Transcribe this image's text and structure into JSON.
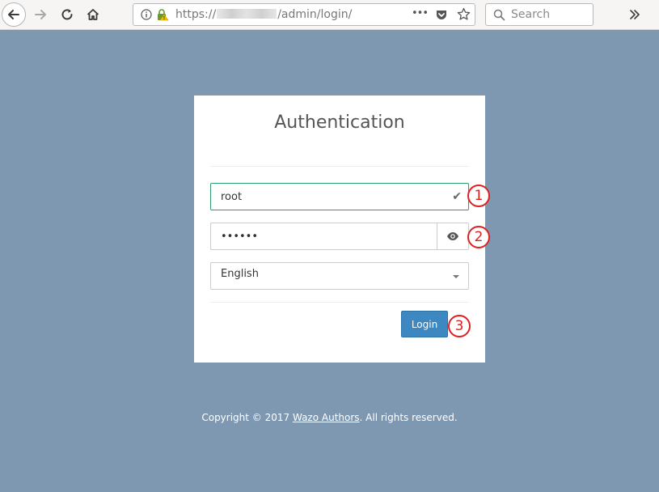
{
  "browser": {
    "url_prefix": "https://",
    "url_path": "/admin/login/",
    "search_placeholder": "Search",
    "more_label": "•••"
  },
  "login": {
    "title": "Authentication",
    "username_value": "root",
    "password_mask": "••••••",
    "language_selected": "English",
    "submit_label": "Login"
  },
  "annotations": [
    "1",
    "2",
    "3"
  ],
  "footer": {
    "prefix": "Copyright © 2017 ",
    "link_text": "Wazo Authors",
    "suffix": ". All rights reserved."
  },
  "colors": {
    "page_background": "#7f98b2",
    "primary_button": "#3d88c1",
    "valid_border": "#2f9e6e",
    "annotation": "#e02020"
  }
}
